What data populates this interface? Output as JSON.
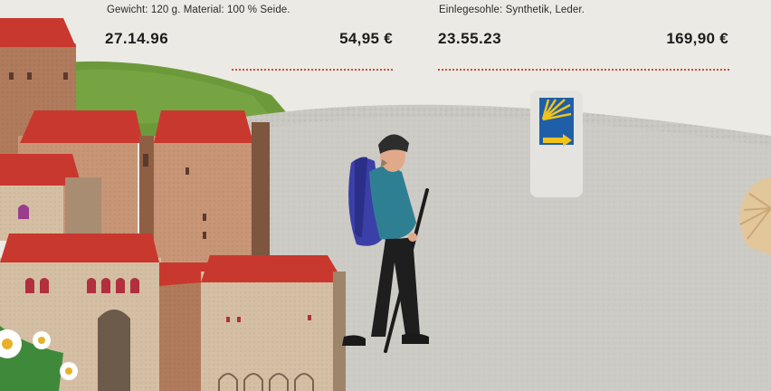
{
  "products": [
    {
      "description": "Gewicht: 120 g. Material: 100 % Seide.",
      "sku": "27.14.96",
      "price": "54,95 €"
    },
    {
      "description": "Einlegesohle: Synthetik, Leder.",
      "sku": "23.55.23",
      "price": "169,90 €"
    }
  ],
  "illustration": {
    "icon_names": [
      "pilgrim-figure",
      "camino-waymarker-icon",
      "scallop-shell-icon",
      "daisy-flower-icon"
    ],
    "colors": {
      "roof_red": "#c9382e",
      "backpack_blue": "#3b3fa8",
      "jacket_teal": "#2f7f93",
      "marker_blue": "#1f5fa8",
      "marker_yellow": "#f2c31b",
      "grass_green": "#6c9a3a"
    }
  }
}
